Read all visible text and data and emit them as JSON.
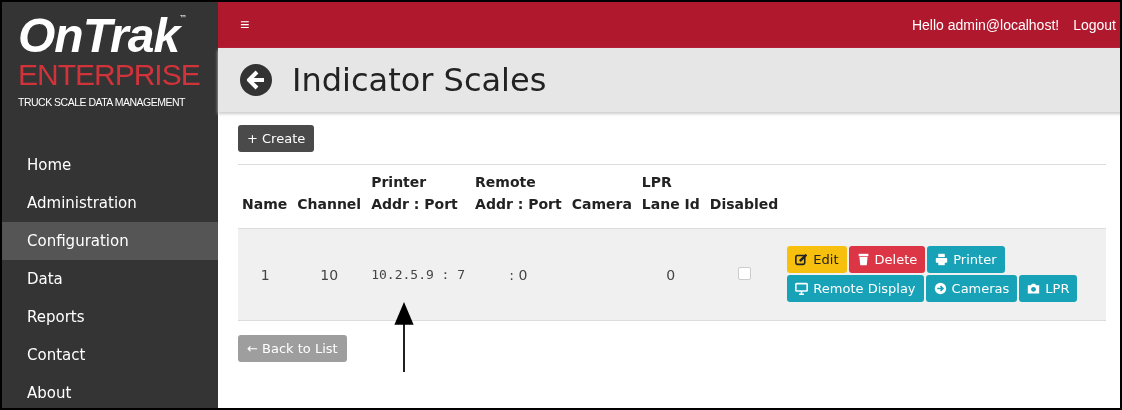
{
  "logo": {
    "name": "OnTrak",
    "tm": "™",
    "line2": "ENTERPRISE",
    "tagline": "TRUCK SCALE DATA MANAGEMENT"
  },
  "sidebar": {
    "items": [
      {
        "label": "Home",
        "selected": false
      },
      {
        "label": "Administration",
        "selected": false
      },
      {
        "label": "Configuration",
        "selected": true
      },
      {
        "label": "Data",
        "selected": false
      },
      {
        "label": "Reports",
        "selected": false
      },
      {
        "label": "Contact",
        "selected": false
      },
      {
        "label": "About",
        "selected": false
      }
    ]
  },
  "topbar": {
    "menu": "≡",
    "greeting": "Hello admin@localhost!",
    "logout": "Logout"
  },
  "page": {
    "title": "Indicator Scales",
    "create": "+ Create",
    "back": "← Back to List"
  },
  "table": {
    "columns": [
      "Name",
      "Channel",
      "Printer\nAddr : Port",
      "Remote\nAddr : Port",
      "Camera",
      "LPR\nLane Id",
      "Disabled"
    ],
    "rows": [
      {
        "cells": [
          "1",
          "10",
          "10.2.5.9 : 7",
          ": 0",
          "",
          "0"
        ],
        "disabled": false,
        "actions": [
          {
            "label": "Edit",
            "kind": "edit"
          },
          {
            "label": "Delete",
            "kind": "delete"
          },
          {
            "label": "Printer",
            "kind": "printer"
          },
          {
            "label": "Remote Display",
            "kind": "display"
          },
          {
            "label": "Cameras",
            "kind": "cameras"
          },
          {
            "label": "LPR",
            "kind": "lpr"
          }
        ]
      }
    ]
  }
}
